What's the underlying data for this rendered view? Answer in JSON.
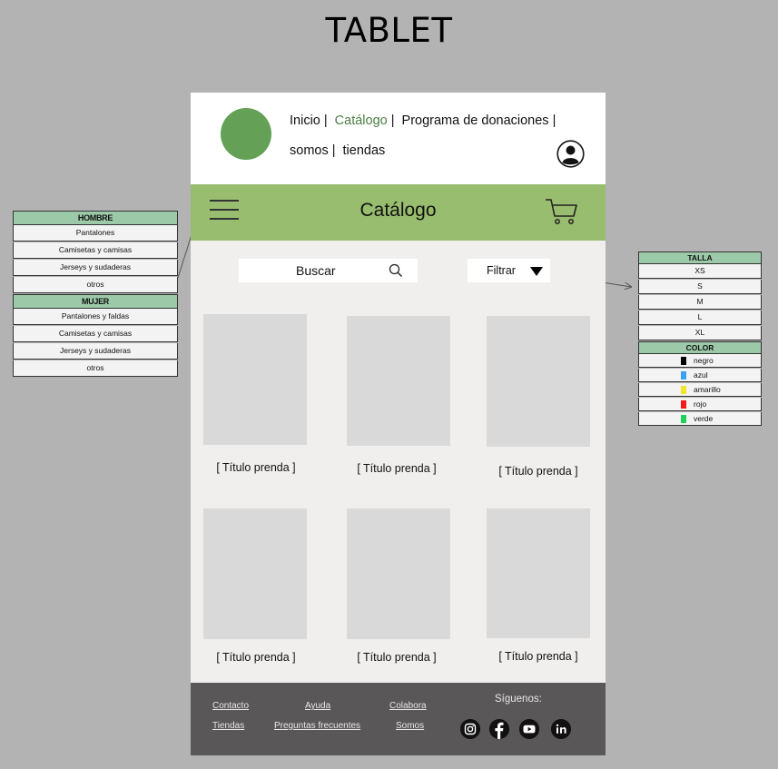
{
  "page_title": "TABLET",
  "side_menu": {
    "sections": [
      {
        "header": "HOMBRE",
        "items": [
          "Pantalones",
          "Camisetas y camisas",
          "Jerseys y sudaderas",
          "otros"
        ]
      },
      {
        "header": "MUJER",
        "items": [
          "Pantalones y faldas",
          "Camisetas y camisas",
          "Jerseys y sudaderas",
          "otros"
        ]
      }
    ]
  },
  "filter_panel": {
    "size_header": "TALLA",
    "sizes": [
      "XS",
      "S",
      "M",
      "L",
      "XL"
    ],
    "color_header": "COLOR",
    "colors": [
      {
        "label": "negro",
        "hex": "#000000"
      },
      {
        "label": "azul",
        "hex": "#3aa0f0"
      },
      {
        "label": "amarillo",
        "hex": "#f2e52a"
      },
      {
        "label": "rojo",
        "hex": "#f21b1b"
      },
      {
        "label": "verde",
        "hex": "#1fd15a"
      }
    ]
  },
  "nav": {
    "inicio": "Inicio",
    "catalogo": "Catálogo",
    "donaciones": "Programa de donaciones",
    "somos": "somos",
    "tiendas": "tiendas",
    "separator": "|"
  },
  "catalog": {
    "title": "Catálogo",
    "search_label": "Buscar",
    "filter_label": "Filtrar"
  },
  "products": [
    {
      "title": "[ Título prenda ]"
    },
    {
      "title": "[ Título prenda ]"
    },
    {
      "title": "[ Título prenda ]"
    },
    {
      "title": "[ Título prenda ]"
    },
    {
      "title": "[ Título prenda ]"
    },
    {
      "title": "[ Título prenda ]"
    }
  ],
  "footer": {
    "contacto": "Contacto",
    "ayuda": "Ayuda",
    "colabora": "Colabora",
    "tiendas": "Tiendas",
    "preguntas": "Preguntas frecuentes",
    "somos": "Somos",
    "siguenos": "Síguenos:",
    "social_icons": [
      "instagram-icon",
      "facebook-icon",
      "youtube-icon",
      "linkedin-icon"
    ]
  },
  "colors": {
    "background": "#b3b3b3",
    "green_bar": "#99bd6e",
    "logo": "#64a056",
    "menu_header": "#9cc9a8",
    "footer": "#595757",
    "nav_active": "#4d7d42"
  }
}
